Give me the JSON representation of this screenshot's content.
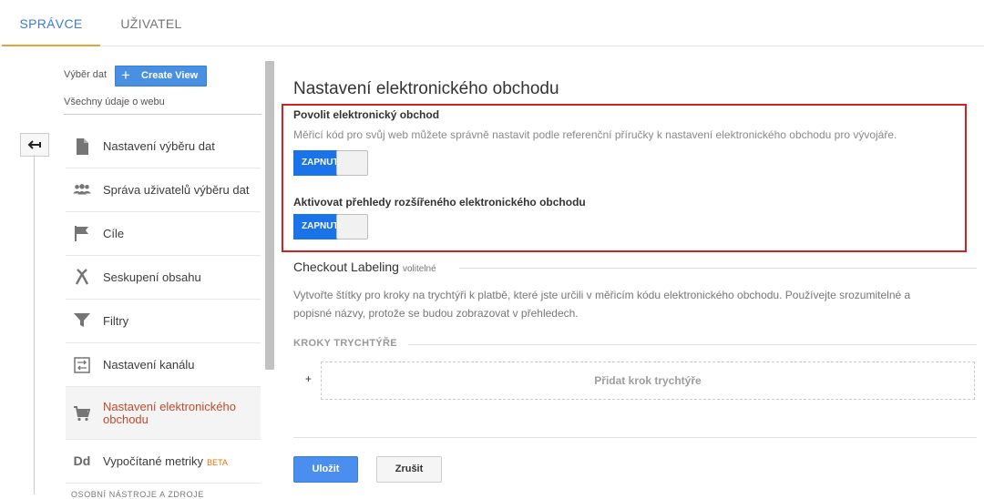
{
  "tabs": {
    "admin": "SPRÁVCE",
    "user": "UŽIVATEL"
  },
  "view": {
    "label": "Výběr dat",
    "create_button": "Create View",
    "name": "Všechny údaje o webu"
  },
  "menu": [
    {
      "label": "Nastavení výběru dat",
      "icon": "document-icon"
    },
    {
      "label": "Správa uživatelů výběru dat",
      "icon": "people-icon"
    },
    {
      "label": "Cíle",
      "icon": "flag-icon"
    },
    {
      "label": "Seskupení obsahu",
      "icon": "merge-icon"
    },
    {
      "label": "Filtry",
      "icon": "filter-icon"
    },
    {
      "label": "Nastavení kanálu",
      "icon": "channel-icon"
    },
    {
      "label": "Nastavení elektronického obchodu",
      "icon": "cart-icon",
      "active": true
    },
    {
      "label": "Vypočítané metriky",
      "icon": "dd-icon",
      "badge": "BETA"
    }
  ],
  "menu_cutoff": "OSOBNÍ NÁSTROJE A ZDROJE",
  "main": {
    "title": "Nastavení elektronického obchodu",
    "enable": {
      "title": "Povolit elektronický obchod",
      "description": "Měřicí kód pro svůj web můžete správně nastavit podle referenční příručky k nastavení elektronického obchodu pro vývojáře.",
      "toggle": "ZAPNUTO"
    },
    "enhanced": {
      "title": "Aktivovat přehledy rozšířeného elektronického obchodu",
      "toggle": "ZAPNUTO"
    },
    "checkout": {
      "title": "Checkout Labeling",
      "optional": "volitelné",
      "description_line1": "Vytvořte štítky pro kroky na trychtýři k platbě, které jste určili v měřicím kódu elektronického obchodu. Používejte srozumitelné a",
      "description_line2": "popisné názvy, protože se budou zobrazovat v přehledech.",
      "steps_header": "KROKY TRYCHTÝŘE",
      "add_plus": "+",
      "add_step": "Přidat krok trychtýře"
    },
    "save": "Uložit",
    "cancel": "Zrušit"
  },
  "colors": {
    "accent": "#1a73e8",
    "active_text": "#c6492c",
    "highlight_box": "#d7201f",
    "tab_underline": "#e8a33b"
  }
}
